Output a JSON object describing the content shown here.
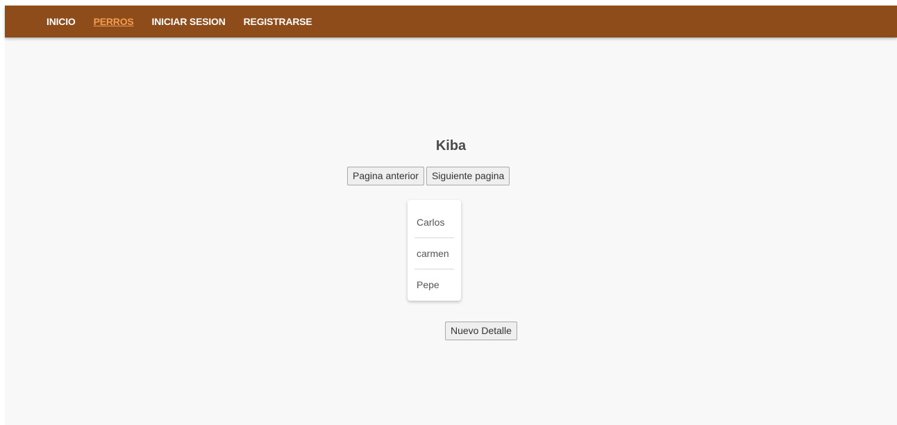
{
  "nav": {
    "links": [
      {
        "label": "INICIO",
        "active": false
      },
      {
        "label": "PERROS",
        "active": true
      },
      {
        "label": "INICIAR SESION",
        "active": false
      },
      {
        "label": "REGISTRARSE",
        "active": false
      }
    ]
  },
  "dog": {
    "name": "Kiba"
  },
  "pager": {
    "prev_label": "Pagina anterior",
    "next_label": "Siguiente pagina"
  },
  "owners": {
    "items": [
      "Carlos",
      "carmen",
      "Pepe"
    ]
  },
  "actions": {
    "new_detail_label": "Nuevo Detalle"
  },
  "colors": {
    "navbar_bg": "#8e4c1a",
    "nav_active": "#f29d52",
    "page_bg": "#f8f8f8"
  }
}
